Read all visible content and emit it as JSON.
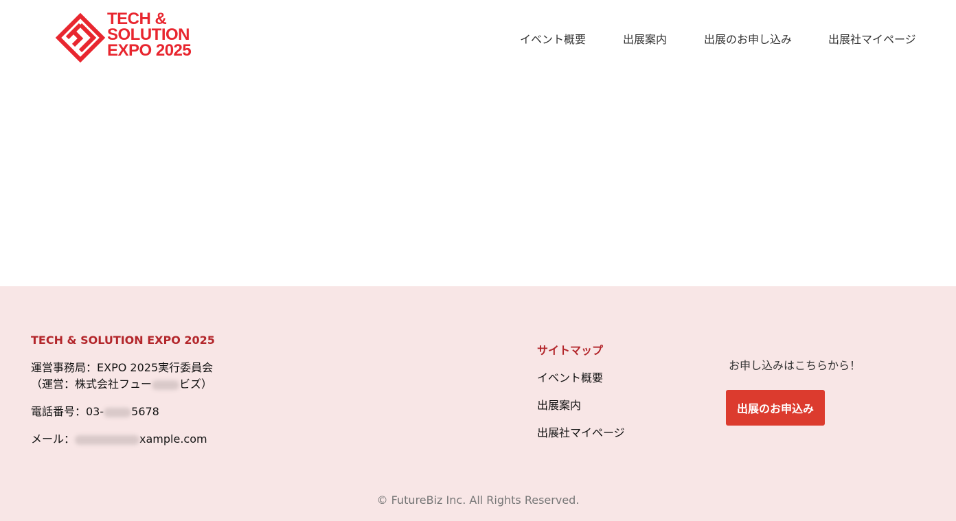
{
  "header": {
    "logo": {
      "line1": "TECH &",
      "line2": "SOLUTION",
      "line3": "EXPO 2025",
      "color": "#e8262f"
    },
    "nav": [
      {
        "label": "イベント概要"
      },
      {
        "label": "出展案内"
      },
      {
        "label": "出展のお申し込み"
      },
      {
        "label": "出展社マイページ"
      }
    ]
  },
  "footer": {
    "background": "#f8e6e6",
    "title": "TECH & SOLUTION EXPO 2025",
    "office_line": "運営事務局：EXPO 2025実行委員会",
    "operator_prefix": "（運営：株式会社フュー",
    "operator_suffix": "ビズ）",
    "phone_prefix": "電話番号：03-",
    "phone_suffix": "5678",
    "mail_prefix": "メール：",
    "mail_suffix": "xample.com",
    "sitemap": {
      "title": "サイトマップ",
      "links": [
        {
          "label": "イベント概要"
        },
        {
          "label": "出展案内"
        },
        {
          "label": "出展社マイページ"
        }
      ]
    },
    "apply": {
      "label": "お申し込みはこちらから！",
      "button": "出展のお申込み",
      "button_color": "#dc3b2e"
    },
    "copyright": "© FutureBiz Inc. All Rights Reserved."
  }
}
